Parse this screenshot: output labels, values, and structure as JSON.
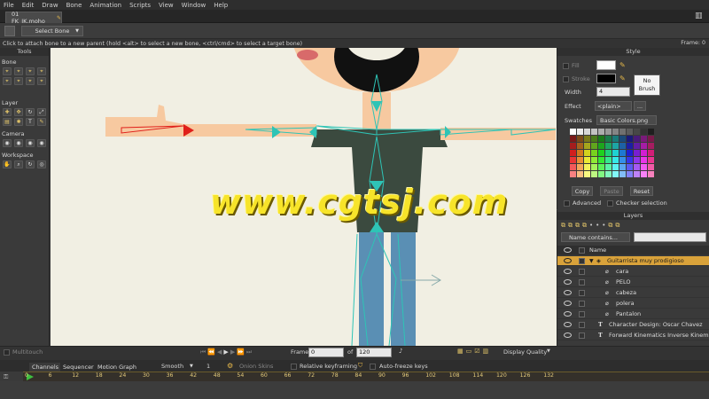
{
  "menu": [
    "File",
    "Edit",
    "Draw",
    "Bone",
    "Animation",
    "Scripts",
    "View",
    "Window",
    "Help"
  ],
  "document_tab": "01 FK_IK.moho",
  "tool_options": {
    "select_bone": "Select Bone"
  },
  "status": {
    "message": "Click to attach bone to a new parent (hold <alt> to select a new bone, <ctrl/cmd> to select a target bone)",
    "frame": "Frame: 0"
  },
  "tools": {
    "title": "Tools",
    "sections": [
      "Bone",
      "Layer",
      "Camera",
      "Workspace"
    ]
  },
  "style": {
    "title": "Style",
    "fill_label": "Fill",
    "stroke_label": "Stroke",
    "width_label": "Width",
    "width_value": "4",
    "no_brush": "No Brush",
    "effect_label": "Effect",
    "effect_value": "<plain>",
    "effect_more": "...",
    "swatches_label": "Swatches",
    "swatches_file": "Basic Colors.png",
    "copy": "Copy",
    "paste": "Paste",
    "reset": "Reset",
    "advanced": "Advanced",
    "checker": "Checker selection",
    "fill_color": "#ffffff",
    "stroke_color": "#000000"
  },
  "layers": {
    "title": "Layers",
    "filter": "Name contains...",
    "name_header": "Name",
    "items": [
      {
        "name": "Guitarrista muy prodigioso",
        "selected": true
      },
      {
        "name": "cara"
      },
      {
        "name": "PELO"
      },
      {
        "name": "cabeza"
      },
      {
        "name": "polera"
      },
      {
        "name": "Pantalon"
      },
      {
        "name": "Character Design: Oscar Chavez"
      },
      {
        "name": "Forward Kinematics Inverse Kinem"
      }
    ]
  },
  "transport": {
    "multitouch": "Multitouch",
    "frame_label": "Frame",
    "frame_value": "0",
    "of_label": "of",
    "total_frames": "120",
    "display_quality": "Display Quality"
  },
  "timeline": {
    "tabs": [
      "Channels",
      "Sequencer",
      "Motion Graph"
    ],
    "interp": "Smooth",
    "interp_num": "1",
    "onion_skins": "Onion Skins",
    "relative_kf": "Relative keyframing",
    "auto_freeze": "Auto-freeze keys",
    "ruler": [
      "0",
      "6",
      "12",
      "18",
      "24",
      "30",
      "36",
      "42",
      "48",
      "54",
      "60",
      "66",
      "72",
      "78",
      "84",
      "90",
      "96",
      "102",
      "108",
      "114",
      "120",
      "126",
      "132"
    ]
  },
  "watermark": "www.cgtsj.com",
  "colors": {
    "accent": "#d9a23a",
    "bone": "#2ec4b6",
    "selected_bone": "#e0201a"
  }
}
